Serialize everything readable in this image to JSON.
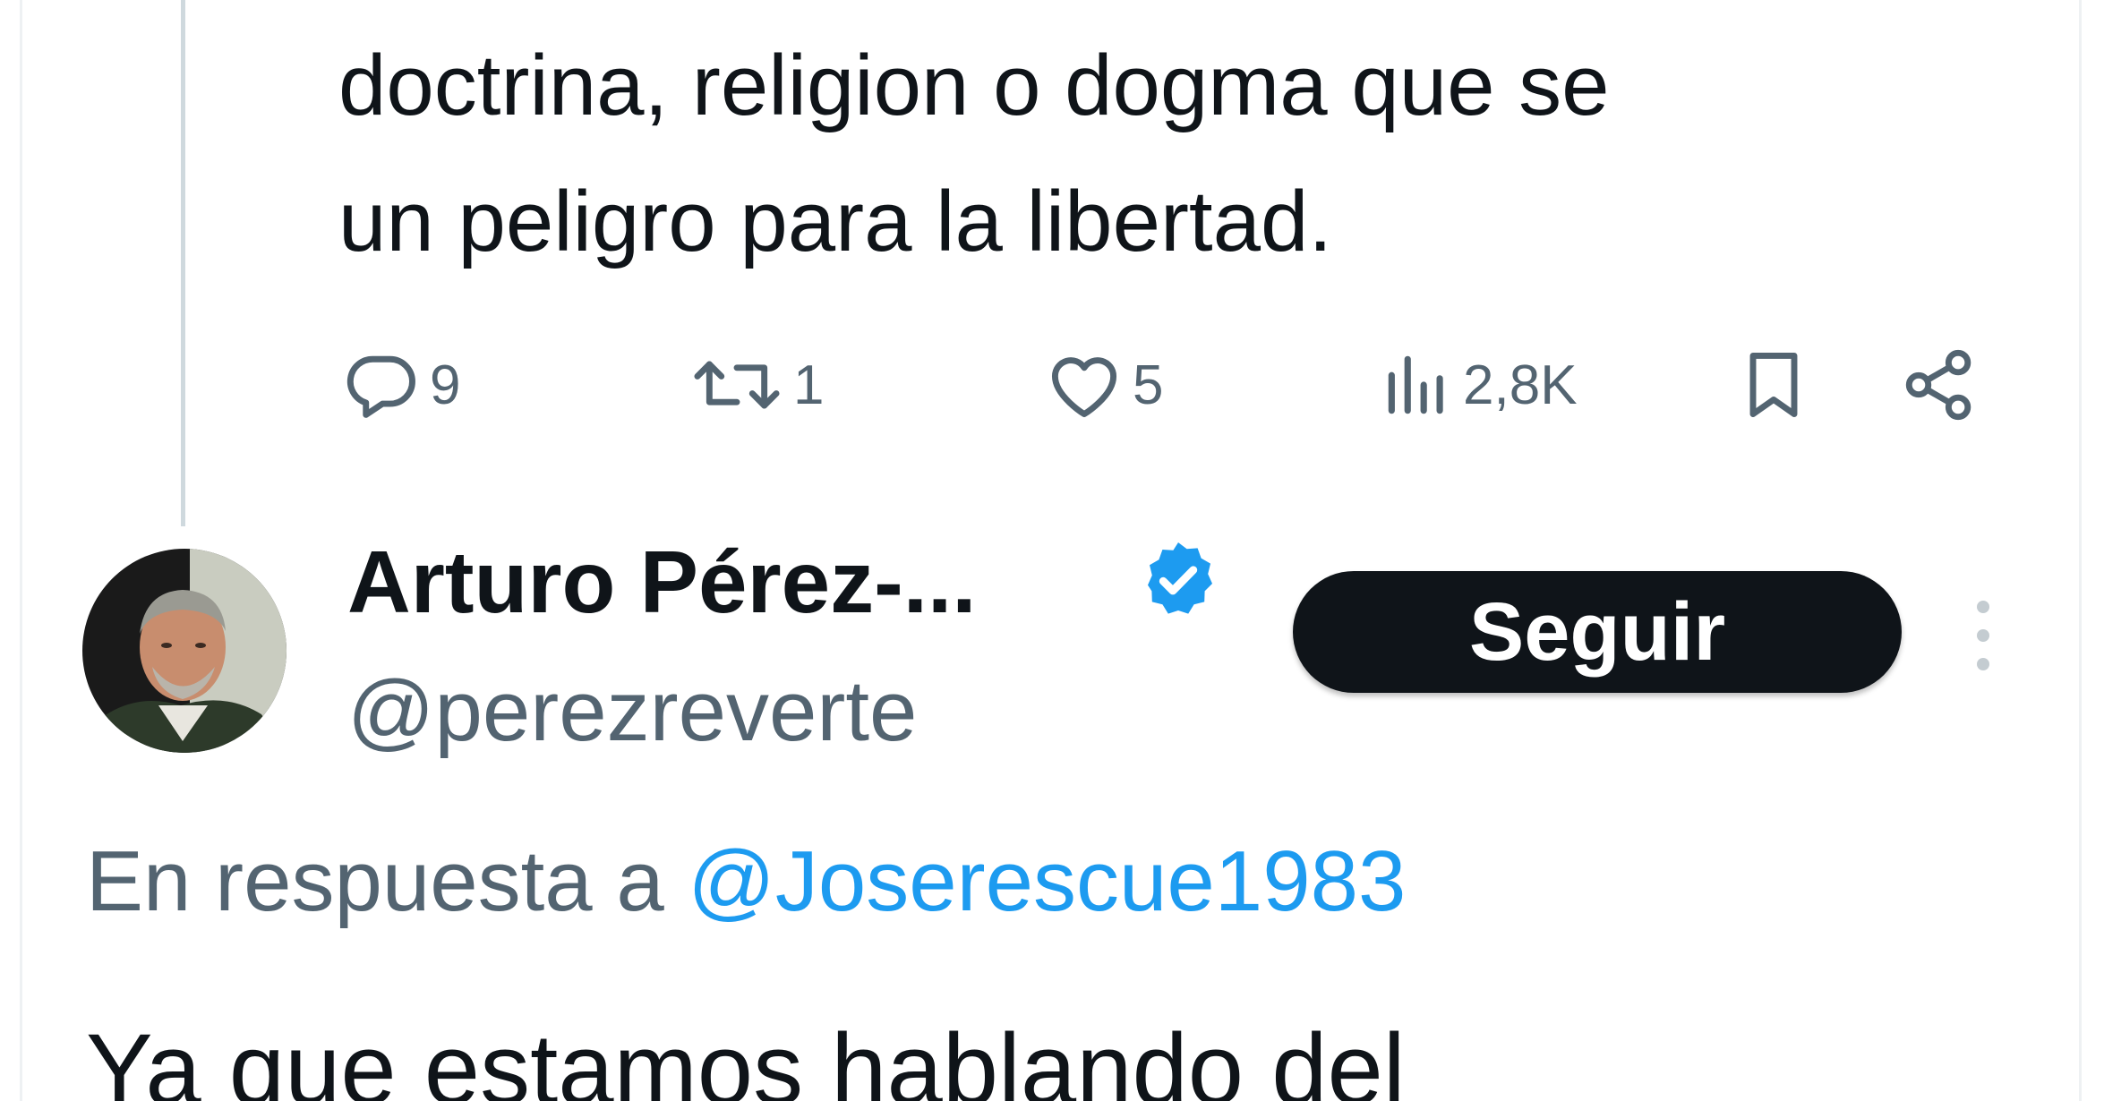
{
  "previous_tweet": {
    "text_lines": [
      "doctrina, religion o dogma que se",
      "un peligro para la libertad."
    ],
    "actions": {
      "replies": "9",
      "retweets": "1",
      "likes": "5",
      "views": "2,8K"
    }
  },
  "tweet": {
    "author_name": "Arturo Pérez-...",
    "handle": "@perezreverte",
    "follow_label": "Seguir",
    "reply_prefix": "En respuesta a ",
    "reply_mention": "@Joserescue1983",
    "text": "Ya que estamos hablando del"
  },
  "icons": {
    "reply": "reply-bubble-icon",
    "retweet": "retweet-icon",
    "like": "heart-icon",
    "views": "views-bars-icon",
    "bookmark": "bookmark-icon",
    "share": "share-icon",
    "verified": "verified-badge-icon",
    "more": "more-vertical-icon"
  },
  "colors": {
    "text": "#0f1419",
    "secondary": "#536471",
    "link": "#1d9bf0",
    "verified": "#1d9bf0",
    "button_bg": "#0f1419",
    "thread_line": "#cfd9de"
  }
}
